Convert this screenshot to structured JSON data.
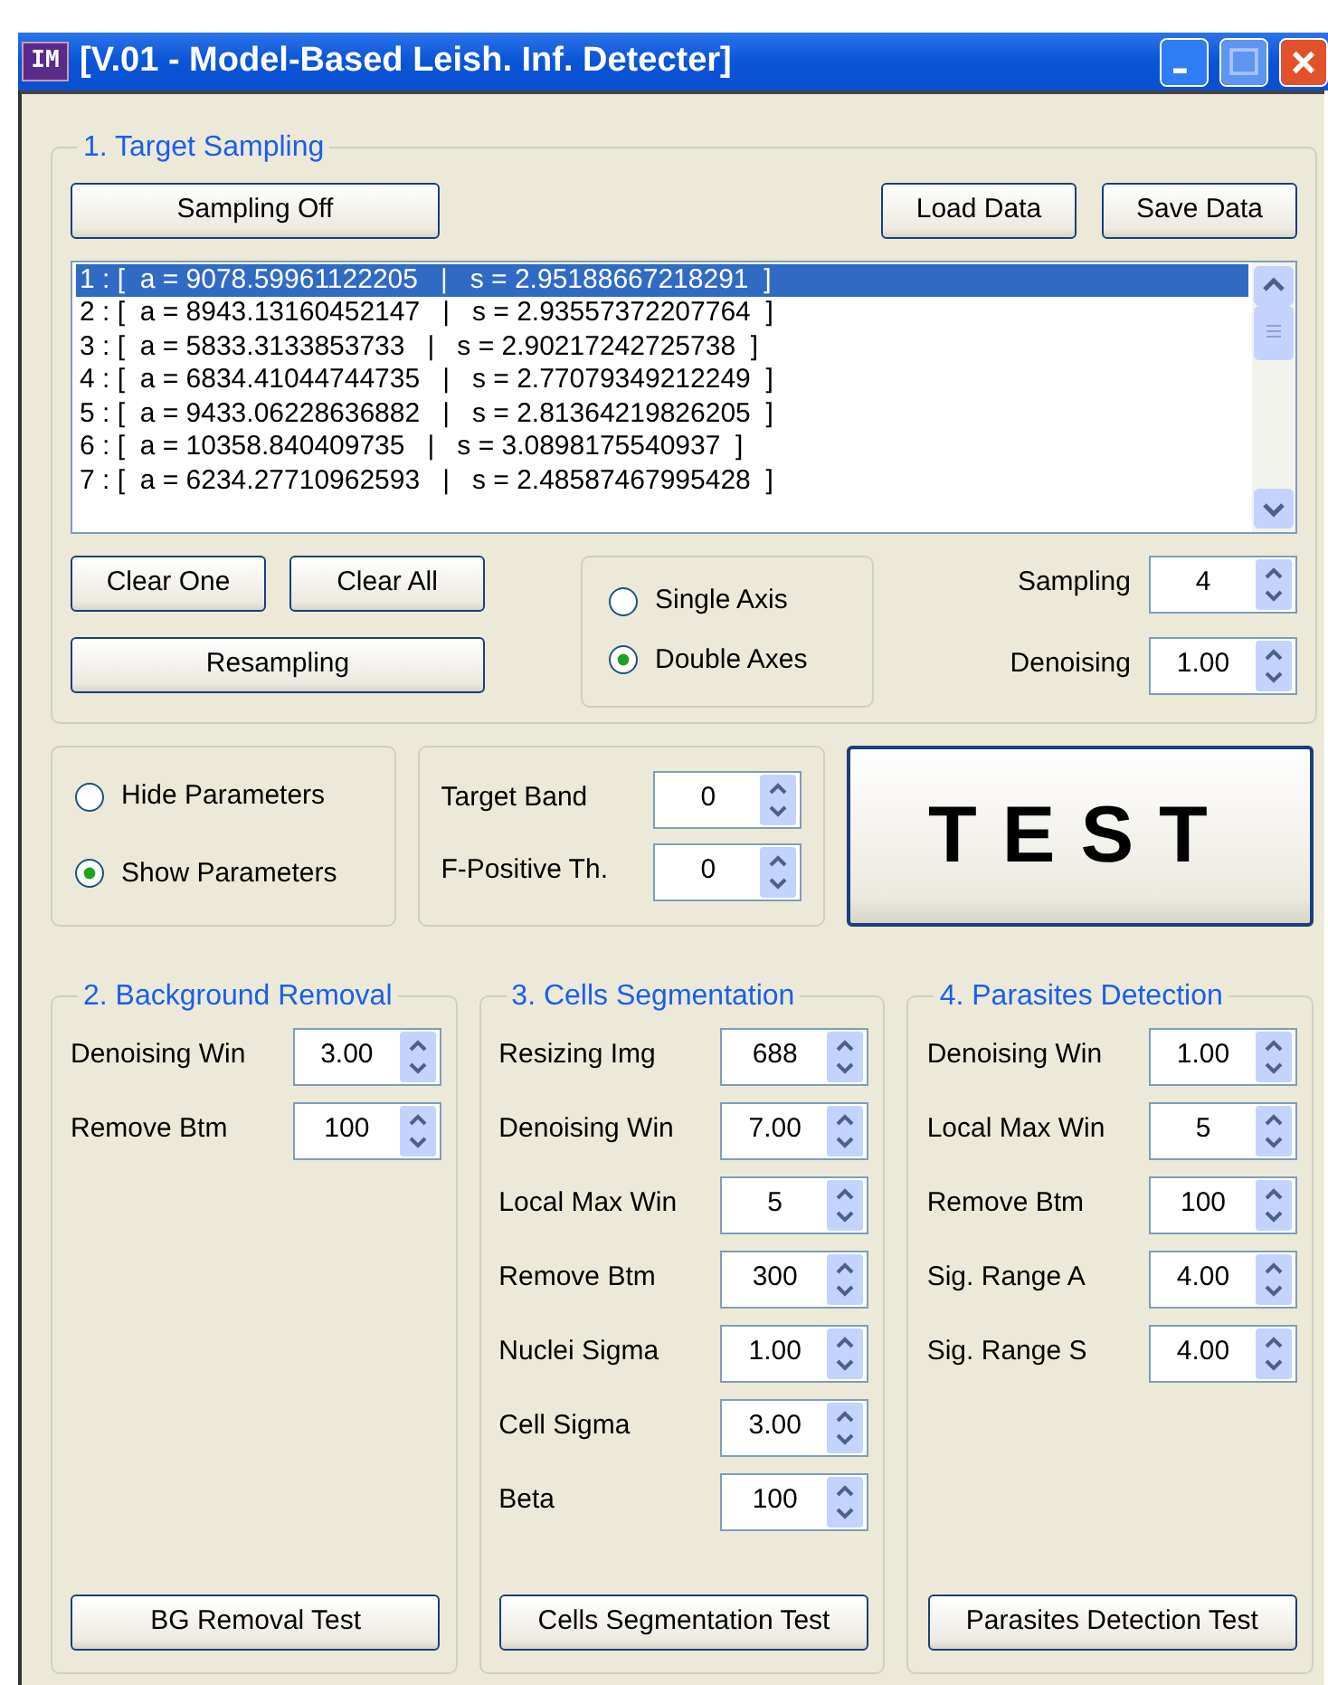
{
  "window": {
    "icon_text": "IM",
    "title": "[V.01 - Model-Based Leish. Inf. Detecter]"
  },
  "target_sampling": {
    "title": "1. Target Sampling",
    "sampling_button": "Sampling Off",
    "load_button": "Load Data",
    "save_button": "Save Data",
    "samples": [
      {
        "label": "1 : [  a = 9078.59961122205   |   s = 2.95188667218291  ]",
        "selected": true
      },
      {
        "label": "2 : [  a = 8943.13160452147   |   s = 2.93557372207764  ]",
        "selected": false
      },
      {
        "label": "3 : [  a = 5833.3133853733   |   s = 2.90217242725738  ]",
        "selected": false
      },
      {
        "label": "4 : [  a = 6834.41044744735   |   s = 2.77079349212249  ]",
        "selected": false
      },
      {
        "label": "5 : [  a = 9433.06228636882   |   s = 2.81364219826205  ]",
        "selected": false
      },
      {
        "label": "6 : [  a = 10358.840409735   |   s = 3.0898175540937  ]",
        "selected": false
      },
      {
        "label": "7 : [  a = 6234.27710962593   |   s = 2.48587467995428  ]",
        "selected": false
      }
    ],
    "clear_one_button": "Clear One",
    "clear_all_button": "Clear All",
    "resampling_button": "Resampling",
    "axes": [
      {
        "label": "Single Axis",
        "selected": false
      },
      {
        "label": "Double Axes",
        "selected": true
      }
    ],
    "fields": [
      {
        "label": "Sampling",
        "value": "4"
      },
      {
        "label": "Denoising",
        "value": "1.00"
      }
    ]
  },
  "parameters_toggle": [
    {
      "label": "Hide Parameters",
      "selected": false
    },
    {
      "label": "Show Parameters",
      "selected": true
    }
  ],
  "band_fields": [
    {
      "label": "Target Band",
      "value": "0"
    },
    {
      "label": "F-Positive Th.",
      "value": "0"
    }
  ],
  "test_button": "TEST",
  "stages": [
    {
      "title": "2. Background Removal",
      "fields": [
        {
          "label": "Denoising Win",
          "value": "3.00"
        },
        {
          "label": "Remove Btm",
          "value": "100"
        }
      ],
      "button": "BG Removal Test"
    },
    {
      "title": "3. Cells Segmentation",
      "fields": [
        {
          "label": "Resizing Img",
          "value": "688"
        },
        {
          "label": "Denoising Win",
          "value": "7.00"
        },
        {
          "label": "Local Max Win",
          "value": "5"
        },
        {
          "label": "Remove Btm",
          "value": "300"
        },
        {
          "label": "Nuclei Sigma",
          "value": "1.00"
        },
        {
          "label": "Cell Sigma",
          "value": "3.00"
        },
        {
          "label": "Beta",
          "value": "100"
        }
      ],
      "button": "Cells Segmentation Test"
    },
    {
      "title": "4. Parasites Detection",
      "fields": [
        {
          "label": "Denoising Win",
          "value": "1.00"
        },
        {
          "label": "Local Max Win",
          "value": "5"
        },
        {
          "label": "Remove Btm",
          "value": "100"
        },
        {
          "label": "Sig. Range A",
          "value": "4.00"
        },
        {
          "label": "Sig. Range S",
          "value": "4.00"
        }
      ],
      "button": "Parasites Detection Test"
    }
  ]
}
